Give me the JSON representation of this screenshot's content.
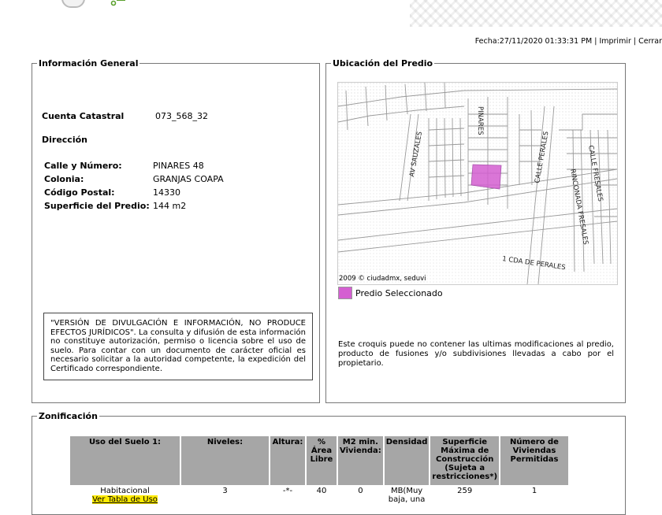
{
  "header": {
    "date_line": "Fecha:27/11/2020 01:33:31 PM",
    "separator": "|",
    "print_label": "Imprimir",
    "close_label": "Cerrar"
  },
  "general": {
    "legend": "Información General",
    "cuenta_label": "Cuenta Catastral",
    "cuenta_value": "073_568_32",
    "direccion_label": "Dirección",
    "calle_label": "Calle y Número:",
    "calle_value": "PINARES 48",
    "colonia_label": "Colonia:",
    "colonia_value": "GRANJAS COAPA",
    "cp_label": "Código Postal:",
    "cp_value": "14330",
    "superficie_label": "Superficie del Predio:",
    "superficie_value": "144 m2",
    "notice": "\"VERSIÓN DE DIVULGACIÓN E INFORMACIÓN, NO PRODUCE EFECTOS JURÍDICOS\". La consulta y difusión de esta información no constituye autorización, permiso o licencia sobre el uso de suelo. Para contar con un documento de carácter oficial es necesario solicitar a la autoridad competente, la expedición del Certificado correspondiente."
  },
  "ubicacion": {
    "legend": "Ubicación del Predio",
    "streets": {
      "av_sauzales": "AV SAUZALES",
      "pinares": "PINARES",
      "calle_perales": "CALLE PERALES",
      "rinconada": "RINCONADA FRESALES",
      "calle_fresales": "CALLE FRESALES",
      "cda_perales": "1 CDA DE PERALES"
    },
    "map_credit": "2009 © ciudadmx, seduvi",
    "legend_label": "Predio Seleccionado",
    "highlight_color": "#d45fd1",
    "croquis_note": "Este croquis puede no contener las ultimas modificaciones al predio, producto de fusiones y/o subdivisiones llevadas a cabo por el propietario."
  },
  "zonificacion": {
    "legend": "Zonificación",
    "headers": [
      "Uso del Suelo 1:",
      "Niveles:",
      "Altura:",
      "% Área Libre",
      "M2 min. Vivienda:",
      "Densidad",
      "Superficie Máxima de Construcción (Sujeta a restricciones*)",
      "Número de Viviendas Permitidas"
    ],
    "row": {
      "uso": "Habitacional",
      "uso_link": "Ver Tabla de Uso",
      "niveles": "3",
      "altura": "-*-",
      "area_libre": "40",
      "m2_min": "0",
      "densidad": "MB(Muy baja, una",
      "superficie": "259",
      "viviendas": "1"
    }
  }
}
